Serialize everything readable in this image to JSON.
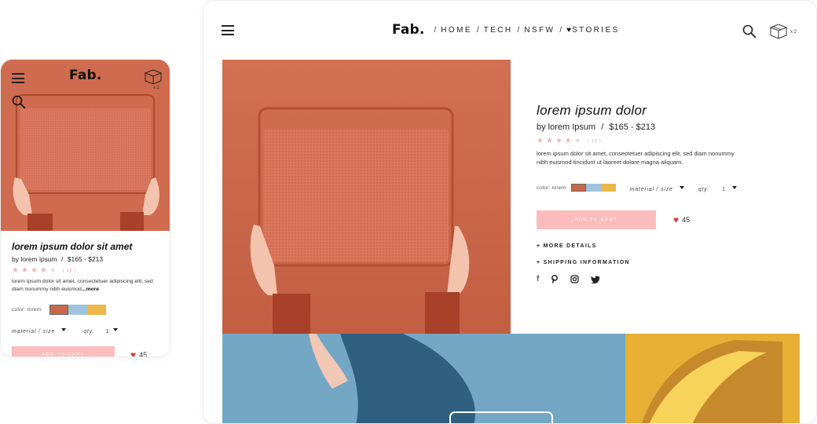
{
  "desktop": {
    "brand": "Fab.",
    "nav": [
      {
        "label": "HOME"
      },
      {
        "label": "TECH"
      },
      {
        "label": "NSFW"
      },
      {
        "label": "STORIES"
      }
    ],
    "cart_count": "x 2",
    "product": {
      "title": "lorem ipsum dolor",
      "by": "by lorem Ipsum",
      "price": "$165 - $213",
      "rating": 4,
      "review_count": "( 13 )",
      "description": "lorem ipsum dolor sit amet, consectetuer adipiscing elit, sed diam nonummy nibh euismod tincidunt ut laoreet dolore magna aliquam.",
      "color_label": "color: lorem",
      "material_label": "material / size",
      "qty_label": "qty.",
      "qty_value": "1",
      "add_to_cart": "ADD TO CART",
      "likes": "45",
      "more_details": "+ MORE DETAILS",
      "shipping": "+ SHIPPING INFORMATION",
      "socials": [
        "facebook-icon",
        "pinterest-icon",
        "instagram-icon",
        "twitter-icon"
      ]
    }
  },
  "mobile": {
    "brand": "Fab.",
    "cart_count": "x 2",
    "product": {
      "title": "lorem ipsum dolor sit amet",
      "by": "by lorem ipsum",
      "price": "$165 - $213",
      "rating": 4,
      "review_count": "( 13 )",
      "description": "lorem ipsum dolor sit amet, consectetuer adipiscing elit, sed diam nonummy nibh euismod",
      "more": "...more",
      "color_label": "color: lorem",
      "material_label": "material / size",
      "qty_label": "qty.",
      "qty_value": "1",
      "add_to_cart": "ADD TO CART",
      "likes": "45"
    }
  },
  "colors": {
    "accent_pink": "#fcbcbc",
    "heart_red": "#d43c3c",
    "terracotta": "#cf6a4d",
    "swatch_terracotta": "#c8684b",
    "swatch_blue": "#9fc3dc",
    "swatch_yellow": "#edb84b"
  }
}
